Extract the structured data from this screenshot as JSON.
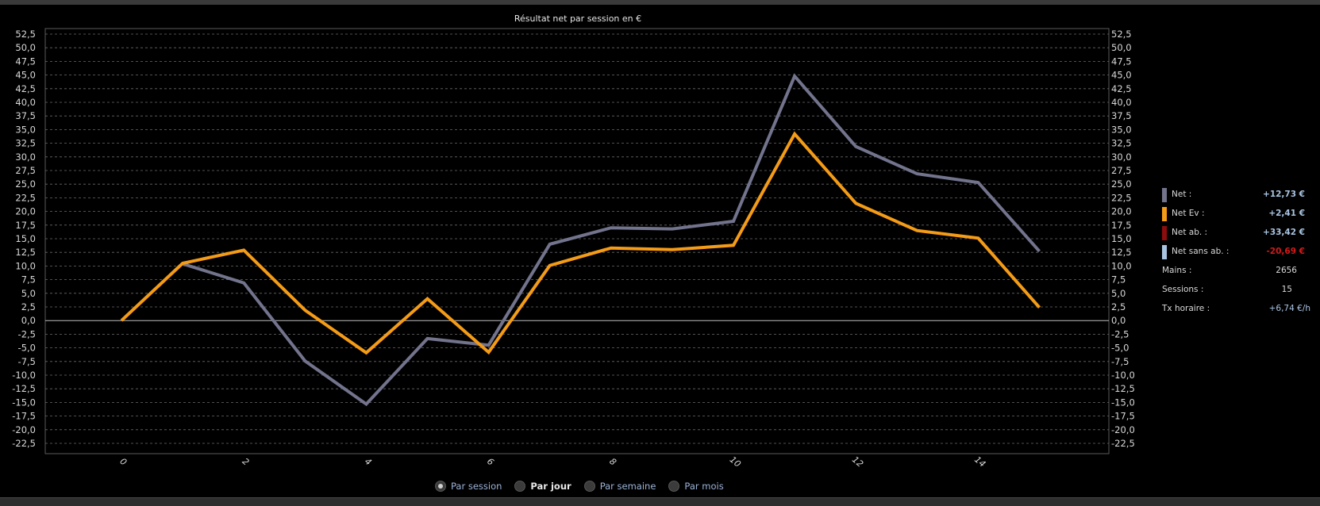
{
  "colors": {
    "net": "#72738c",
    "net_ev": "#f49b17",
    "net_ab": "#8b0d0d",
    "net_sans_ab": "#a9c4e2",
    "positive": "#a9c4e2",
    "negative": "#d21a1a"
  },
  "chart_data": {
    "type": "line",
    "title": "Résultat net par session en €",
    "x": [
      0,
      1,
      2,
      3,
      4,
      5,
      6,
      7,
      8,
      9,
      10,
      11,
      12,
      13,
      14,
      15
    ],
    "x_tick_labels": [
      "0",
      "2",
      "4",
      "6",
      "8",
      "10",
      "12",
      "14"
    ],
    "x_tick_values": [
      0,
      2,
      4,
      6,
      8,
      10,
      12,
      14
    ],
    "y_tick_labels": [
      "52,5",
      "50,0",
      "47,5",
      "45,0",
      "42,5",
      "40,0",
      "37,5",
      "35,0",
      "32,5",
      "30,0",
      "27,5",
      "25,0",
      "22,5",
      "20,0",
      "17,5",
      "15,0",
      "12,5",
      "10,0",
      "7,5",
      "5,0",
      "2,5",
      "0,0",
      "-2,5",
      "-5,0",
      "-7,5",
      "-10,0",
      "-12,5",
      "-15,0",
      "-17,5",
      "-20,0",
      "-22,5"
    ],
    "ylim": [
      -25,
      52.5
    ],
    "grid": true,
    "series": [
      {
        "name": "Net",
        "color": "#72738c",
        "values": [
          null,
          10.4,
          6.9,
          -7.4,
          -15.3,
          -3.3,
          -4.5,
          14.0,
          17.0,
          16.8,
          18.2,
          44.8,
          31.9,
          26.9,
          25.3,
          12.7
        ]
      },
      {
        "name": "Net Ev",
        "color": "#f49b17",
        "values": [
          0,
          10.5,
          12.9,
          1.9,
          -5.9,
          4.0,
          -5.8,
          10.1,
          13.3,
          13.0,
          13.8,
          34.2,
          21.5,
          16.5,
          15.1,
          2.4
        ]
      }
    ],
    "tick_display_overrides": {
      "45,0": "-15,0",
      "42,5": "-12,5",
      "40,0": "-10,0",
      "47,5": "-17,5"
    }
  },
  "legend": {
    "items": [
      {
        "label": "Net :",
        "value": "+12,73 €",
        "color": "#72738c",
        "value_color": "#a9c4e2"
      },
      {
        "label": "Net Ev :",
        "value": "+2,41 €",
        "color": "#f49b17",
        "value_color": "#a9c4e2"
      },
      {
        "label": "Net ab. :",
        "value": "+33,42 €",
        "color": "#8b0d0d",
        "value_color": "#a9c4e2"
      },
      {
        "label": "Net sans ab. :",
        "value": "-20,69 €",
        "color": "#a9c4e2",
        "value_color": "#d21a1a"
      }
    ],
    "stats": [
      {
        "label": "Mains :",
        "value": "2656"
      },
      {
        "label": "Sessions :",
        "value": "15"
      },
      {
        "label": "Tx horaire :",
        "value": "+6,74 €/h",
        "value_color": "#a9c4e2"
      }
    ]
  },
  "view_options": [
    {
      "label": "Par session",
      "selected": true
    },
    {
      "label": "Par jour",
      "selected": false
    },
    {
      "label": "Par semaine",
      "selected": false
    },
    {
      "label": "Par mois",
      "selected": false
    }
  ]
}
